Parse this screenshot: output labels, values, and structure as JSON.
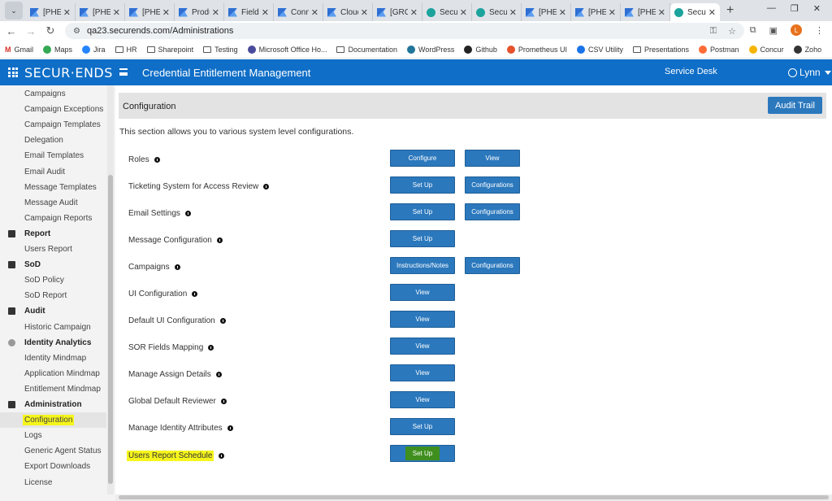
{
  "browser": {
    "tabs": [
      {
        "label": "[PHE",
        "icon": "flag"
      },
      {
        "label": "[PHE",
        "icon": "flag"
      },
      {
        "label": "[PHE",
        "icon": "flag"
      },
      {
        "label": "Produ",
        "icon": "flag"
      },
      {
        "label": "Field",
        "icon": "flag"
      },
      {
        "label": "Conn",
        "icon": "flag"
      },
      {
        "label": "Cloud",
        "icon": "flag"
      },
      {
        "label": "[GRC",
        "icon": "flag"
      },
      {
        "label": "Secur",
        "icon": "circle"
      },
      {
        "label": "Secur",
        "icon": "circle"
      },
      {
        "label": "[PHE",
        "icon": "flag"
      },
      {
        "label": "[PHE",
        "icon": "flag"
      },
      {
        "label": "[PHE",
        "icon": "flag"
      },
      {
        "label": "Secu",
        "icon": "circle",
        "active": true
      }
    ],
    "url": "qa23.securends.com/Administrations",
    "profile_initial": "L",
    "bookmarks": [
      "Gmail",
      "Maps",
      "Jira",
      "HR",
      "Sharepoint",
      "Testing",
      "Microsoft Office Ho...",
      "Documentation",
      "WordPress",
      "Github",
      "Prometheus UI",
      "CSV Utility",
      "Presentations",
      "Postman",
      "Concur",
      "Zoho"
    ]
  },
  "app": {
    "logo": "SECUR·ENDS",
    "title": "Credential Entitlement Management",
    "service_desk": "Service Desk",
    "user": "Lynn",
    "accent": "#0f6ec7"
  },
  "sidebar": {
    "items": [
      {
        "label": "Campaigns",
        "type": "sub"
      },
      {
        "label": "Campaign Exceptions",
        "type": "sub"
      },
      {
        "label": "Campaign Templates",
        "type": "sub"
      },
      {
        "label": "Delegation",
        "type": "sub"
      },
      {
        "label": "Email Templates",
        "type": "sub"
      },
      {
        "label": "Email Audit",
        "type": "sub"
      },
      {
        "label": "Message Templates",
        "type": "sub"
      },
      {
        "label": "Message Audit",
        "type": "sub"
      },
      {
        "label": "Campaign Reports",
        "type": "sub"
      },
      {
        "label": "Report",
        "type": "section"
      },
      {
        "label": "Users Report",
        "type": "sub"
      },
      {
        "label": "SoD",
        "type": "section"
      },
      {
        "label": "SoD Policy",
        "type": "sub"
      },
      {
        "label": "SoD Report",
        "type": "sub"
      },
      {
        "label": "Audit",
        "type": "section"
      },
      {
        "label": "Historic Campaign",
        "type": "sub"
      },
      {
        "label": "Identity Analytics",
        "type": "section"
      },
      {
        "label": "Identity Mindmap",
        "type": "sub"
      },
      {
        "label": "Application Mindmap",
        "type": "sub"
      },
      {
        "label": "Entitlement Mindmap",
        "type": "sub"
      },
      {
        "label": "Administration",
        "type": "section"
      },
      {
        "label": "Configuration",
        "type": "sub",
        "active": true,
        "highlighted": true
      },
      {
        "label": "Logs",
        "type": "sub"
      },
      {
        "label": "Generic Agent Status",
        "type": "sub"
      },
      {
        "label": "Export Downloads",
        "type": "sub"
      },
      {
        "label": "License",
        "type": "sub"
      }
    ]
  },
  "config": {
    "header": "Configuration",
    "audit_trail": "Audit Trail",
    "description": "This section allows you to various system level configurations.",
    "rows": [
      {
        "label": "Roles",
        "buttons": [
          "Configure",
          "View"
        ]
      },
      {
        "label": "Ticketing System for Access Review",
        "buttons": [
          "Set Up",
          "Configurations"
        ]
      },
      {
        "label": "Email Settings",
        "buttons": [
          "Set Up",
          "Configurations"
        ]
      },
      {
        "label": "Message Configuration",
        "buttons": [
          "Set Up"
        ]
      },
      {
        "label": "Campaigns",
        "buttons": [
          "Instructions/Notes",
          "Configurations"
        ]
      },
      {
        "label": "UI Configuration",
        "buttons": [
          "View"
        ]
      },
      {
        "label": "Default UI Configuration",
        "buttons": [
          "View"
        ]
      },
      {
        "label": "SOR Fields Mapping",
        "buttons": [
          "View"
        ]
      },
      {
        "label": "Manage Assign Details",
        "buttons": [
          "View"
        ]
      },
      {
        "label": "Global Default Reviewer",
        "buttons": [
          "View"
        ]
      },
      {
        "label": "Manage Identity Attributes",
        "buttons": [
          "Set Up"
        ]
      },
      {
        "label": "Users Report Schedule",
        "buttons": [
          "Set Up"
        ],
        "highlighted": true
      }
    ]
  }
}
